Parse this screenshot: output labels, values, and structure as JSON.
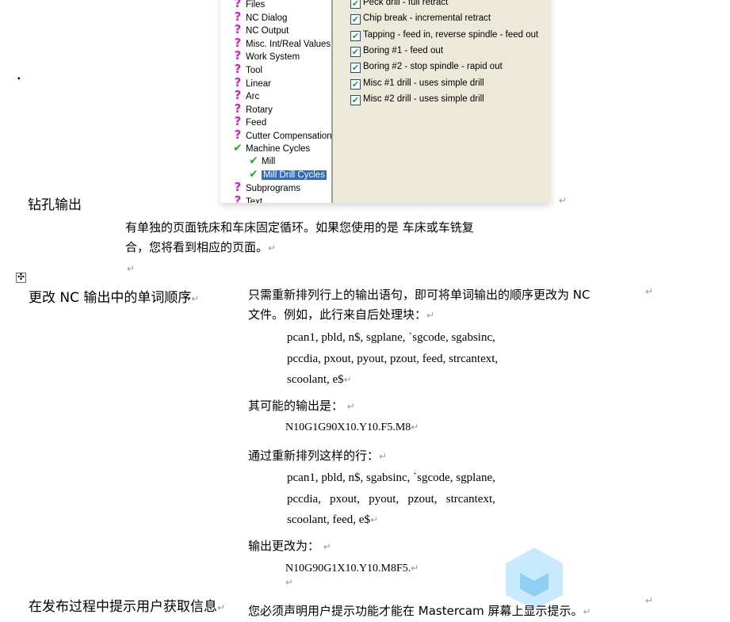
{
  "screenshot": {
    "tree_items": [
      {
        "label": "Files",
        "icon": "question"
      },
      {
        "label": "NC Dialog",
        "icon": "question"
      },
      {
        "label": "NC Output",
        "icon": "question"
      },
      {
        "label": "Misc. Int/Real Values",
        "icon": "question"
      },
      {
        "label": "Work System",
        "icon": "question"
      },
      {
        "label": "Tool",
        "icon": "question"
      },
      {
        "label": "Linear",
        "icon": "question"
      },
      {
        "label": "Arc",
        "icon": "question"
      },
      {
        "label": "Rotary",
        "icon": "question"
      },
      {
        "label": "Feed",
        "icon": "question"
      },
      {
        "label": "Cutter Compensation",
        "icon": "question"
      },
      {
        "label": "Machine Cycles",
        "icon": "check"
      },
      {
        "label": "Mill",
        "icon": "check",
        "indent": 1
      },
      {
        "label": "Mill Drill Cycles",
        "icon": "check",
        "indent": 1,
        "selected": true
      },
      {
        "label": "Subprograms",
        "icon": "question"
      },
      {
        "label": "Text",
        "icon": "question"
      }
    ],
    "checkboxes": [
      {
        "label": "Peck drill - full retract",
        "checked": true
      },
      {
        "label": "Chip break - incremental retract",
        "checked": true
      },
      {
        "label": "Tapping - feed in, reverse spindle - feed out",
        "checked": true
      },
      {
        "label": "Boring #1 - feed out",
        "checked": true
      },
      {
        "label": "Boring #2 - stop spindle - rapid out",
        "checked": true
      },
      {
        "label": "Misc #1 drill - uses simple drill",
        "checked": true
      },
      {
        "label": "Misc #2 drill - uses simple drill",
        "checked": true
      }
    ],
    "selection_color": "#316ac5",
    "panel_color": "#ece9d8"
  },
  "doc": {
    "bullet": "▪",
    "h1": "钻孔输出",
    "p1_line1": "有单独的页面铣床和车床固定循环。如果您使用的是 车床或车铣复",
    "p1_line2": "合，您将看到相应的页面。",
    "h2": "更改 NC 输出中的单词顺序",
    "p2_line1": "只需重新排列行上的输出语句，即可将单词输出的顺序更改为 NC",
    "p2_line2": "文件。例如，此行来自后处理块：",
    "code1": [
      "pcan1, pbld, n$, sgplane, `sgcode, sgabsinc,",
      "pccdia, pxout, pyout, pzout, feed, strcantext,",
      "scoolant, e$"
    ],
    "p3": "其可能的输出是：",
    "out1": "N10G1G90X10.Y10.F5.M8",
    "p4": "通过重新排列这样的行：",
    "code2": [
      "pcan1, pbld, n$, sgabsinc, `sgcode, sgplane,",
      "pccdia,   pxout,   pyout,   pzout,   strcantext,",
      "scoolant, feed, e$"
    ],
    "p5": "输出更改为：",
    "out2": "N10G90G1X10.Y10.M8F5.",
    "h3": "在发布过程中提示用户获取信息",
    "p6": "您必须声明用户提示功能才能在 Mastercam 屏幕上显示提示。",
    "para_mark": "↵"
  }
}
